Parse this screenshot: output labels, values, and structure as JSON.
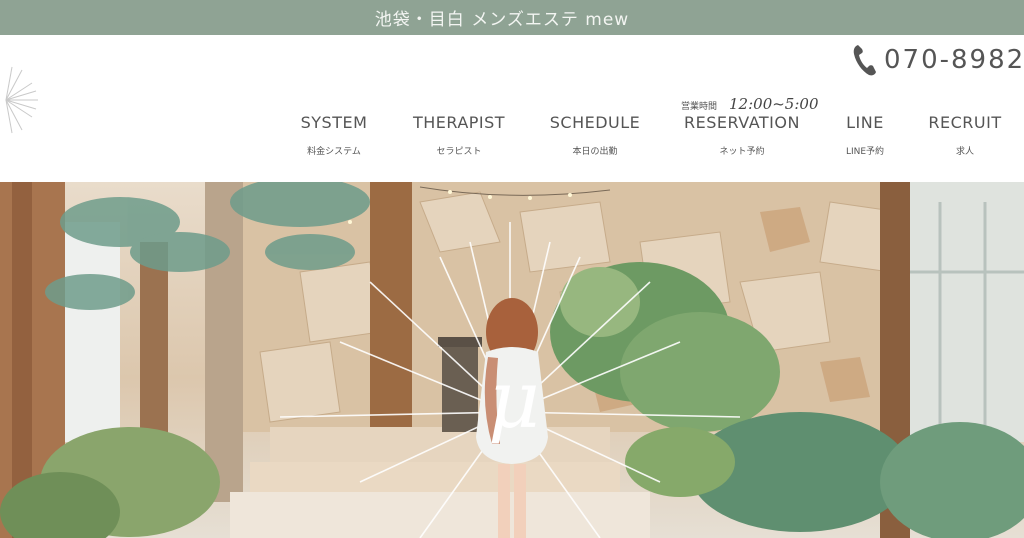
{
  "banner": {
    "text": "池袋・目白 メンズエステ mew"
  },
  "header": {
    "hours_label": "営業時間",
    "hours_value": "12:00~5:00",
    "phone": "070-8982-"
  },
  "nav": [
    {
      "en": "SYSTEM",
      "jp": "料金システム"
    },
    {
      "en": "THERAPIST",
      "jp": "セラピスト"
    },
    {
      "en": "SCHEDULE",
      "jp": "本日の出勤"
    },
    {
      "en": "RESERVATION",
      "jp": "ネット予約"
    },
    {
      "en": "LINE",
      "jp": "LINE予約"
    },
    {
      "en": "RECRUIT",
      "jp": "求人"
    }
  ],
  "hero": {
    "logo_mark": "μ"
  },
  "colors": {
    "banner": "#8fa394",
    "text": "#555555",
    "accent_stone": "#d9c2a4"
  },
  "icons": [
    "sunburst-logo-icon",
    "phone-icon"
  ]
}
